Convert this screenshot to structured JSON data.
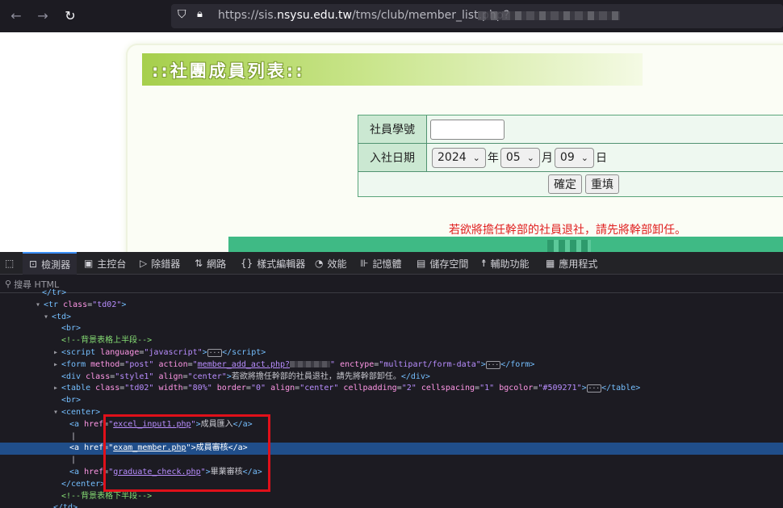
{
  "browser": {
    "url_prefix": "https://sis.",
    "url_domain": "nsysu.edu.tw",
    "url_path": "/tms/club/member_list.php?"
  },
  "page": {
    "title": "::社團成員列表::",
    "form": {
      "member_id_label": "社員學號",
      "member_id_value": "",
      "join_date_label": "入社日期",
      "year": "2024",
      "year_unit": "年",
      "month": "05",
      "month_unit": "月",
      "day": "09",
      "day_unit": "日",
      "confirm_label": "確定",
      "reset_label": "重填"
    },
    "warning": "若欲將擔任幹部的社員退社，請先將幹部卸任。"
  },
  "devtools": {
    "tabs": [
      {
        "icon": "⊡",
        "label": "檢測器"
      },
      {
        "icon": "▣",
        "label": "主控台"
      },
      {
        "icon": "▷",
        "label": "除錯器"
      },
      {
        "icon": "⇅",
        "label": "網路"
      },
      {
        "icon": "{}",
        "label": "樣式編輯器"
      },
      {
        "icon": "◔",
        "label": "效能"
      },
      {
        "icon": "⊪",
        "label": "記憶體"
      },
      {
        "icon": "▤",
        "label": "儲存空間"
      },
      {
        "icon": "☨",
        "label": "輔助功能"
      },
      {
        "icon": "▦",
        "label": "應用程式"
      }
    ],
    "search_placeholder": "搜尋 HTML",
    "code": {
      "tr_class": "td02",
      "comment_top": "<!--背景表格上半段-->",
      "script_lang": "javascript",
      "form_method": "post",
      "form_action": "member_add_act.php?",
      "form_enctype": "multipart/form-data",
      "div_class": "style1",
      "div_align": "center",
      "div_text": "若欲將擔任幹部的社員退社，請先將幹部卸任。",
      "table_class": "td02",
      "table_width": "80%",
      "table_border": "0",
      "table_align": "center",
      "table_cellpadding": "2",
      "table_cellspacing": "1",
      "table_bgcolor": "#509271",
      "link1_href": "excel_input1.php",
      "link1_text": "成員匯入",
      "link2_href": "exam_member.php",
      "link2_text": "成員審核",
      "link3_href": "graduate_check.php",
      "link3_text": "畢業審核",
      "pipe": "|",
      "comment_bottom": "<!--背景表格下半段-->"
    }
  }
}
